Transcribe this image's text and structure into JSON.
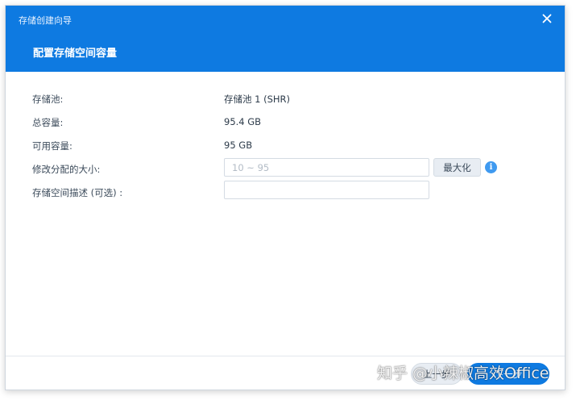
{
  "window": {
    "title": "存储创建向导"
  },
  "header": {
    "step_title": "配置存储空间容量"
  },
  "rows": [
    {
      "label": "存储池:",
      "value": "存储池 1 (SHR)"
    },
    {
      "label": "总容量:",
      "value": "95.4 GB"
    },
    {
      "label": "可用容量:",
      "value": "95 GB"
    }
  ],
  "resize": {
    "label": "修改分配的大小:",
    "placeholder": "10 ~ 95",
    "max_label": "最大化",
    "info_glyph": "i"
  },
  "description": {
    "label": "存储空间描述 (可选) :",
    "value": ""
  },
  "footer": {
    "back_label": "上一步",
    "next_label": "下一步"
  },
  "watermark": {
    "text": "知乎 @小辣椒高效Office"
  },
  "colors": {
    "accent": "#0e7ae1",
    "info": "#3f9af0"
  },
  "icons": {
    "close": "close-icon",
    "info": "info-icon"
  }
}
